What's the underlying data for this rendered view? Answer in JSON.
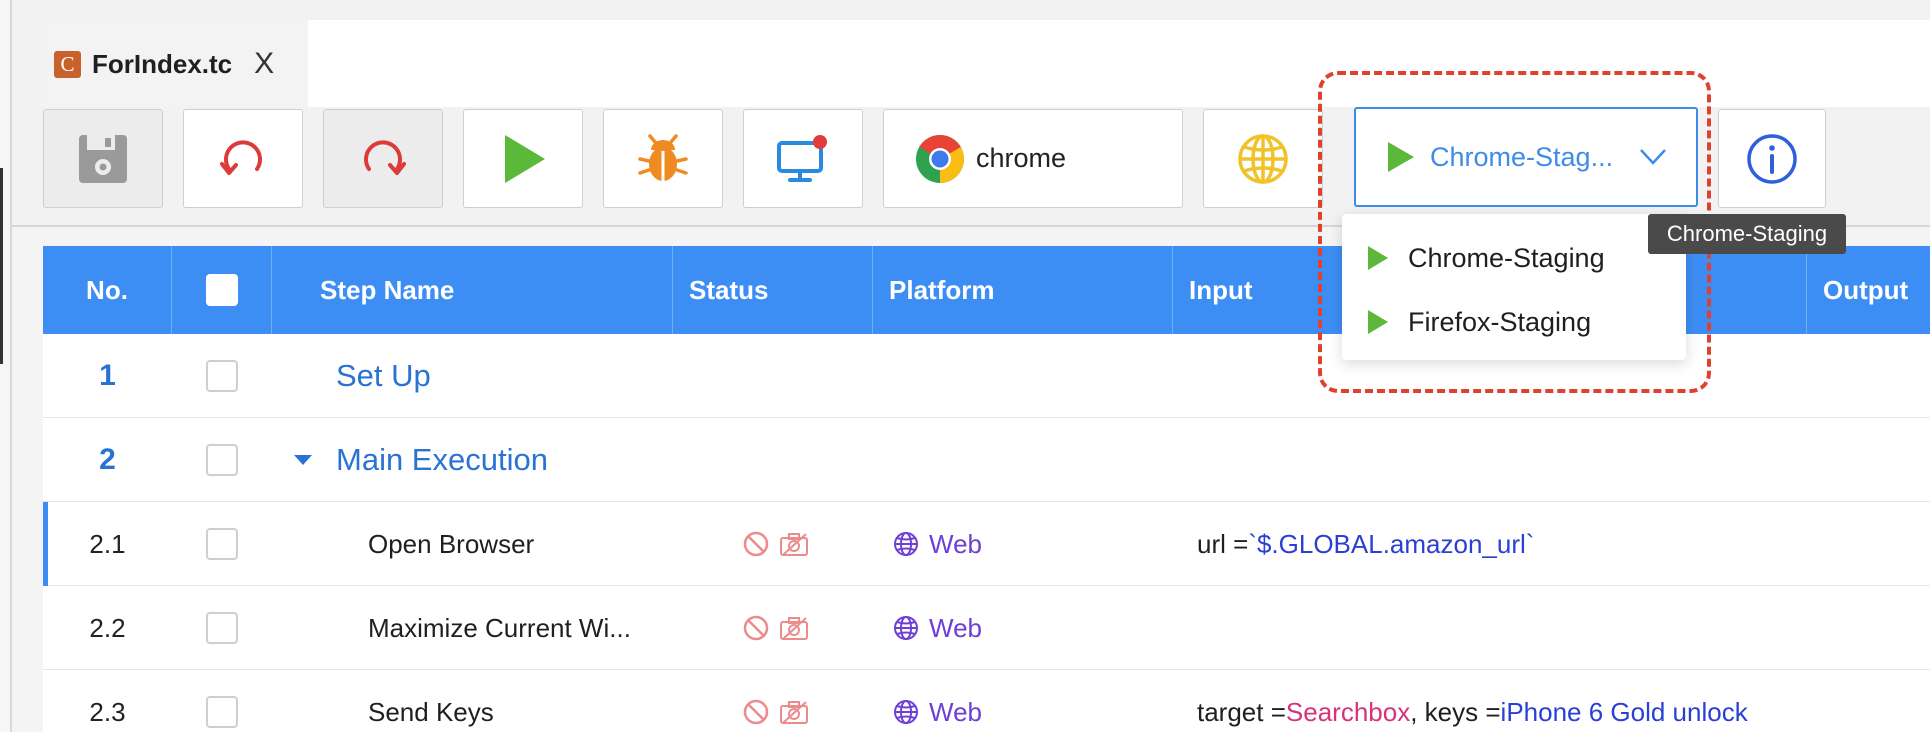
{
  "file_tab": {
    "icon_letter": "C",
    "name": "ForIndex.tc",
    "close": "X"
  },
  "toolbar": {
    "save": "save-icon",
    "undo": "undo-icon",
    "redo": "redo-icon",
    "run": "play-icon",
    "debug": "bug-icon",
    "remote": "monitor-icon",
    "browser_label": "chrome",
    "globe": "globe-icon",
    "environment_selected": "Chrome-Stag...",
    "info": "info-icon"
  },
  "environment_menu": {
    "items": [
      {
        "label": "Chrome-Staging"
      },
      {
        "label": "Firefox-Staging"
      }
    ],
    "tooltip": "Chrome-Staging"
  },
  "table": {
    "columns": {
      "no": "No.",
      "step_name": "Step Name",
      "status": "Status",
      "platform": "Platform",
      "input": "Input",
      "output": "Output"
    },
    "rows": [
      {
        "no": "1",
        "name": "Set Up",
        "type": "group"
      },
      {
        "no": "2",
        "name": "Main Execution",
        "type": "group"
      },
      {
        "no": "2.1",
        "name": "Open Browser",
        "platform": "Web",
        "input_key": "url = ",
        "input_value": "`$.GLOBAL.amazon_url`"
      },
      {
        "no": "2.2",
        "name": "Maximize Current Wi...",
        "platform": "Web"
      },
      {
        "no": "2.3",
        "name": "Send Keys",
        "platform": "Web",
        "input_key": "target = ",
        "input_value_pink": "Searchbox",
        "input_key2": ", keys = ",
        "input_value": "iPhone 6 Gold unlock"
      }
    ]
  },
  "colors": {
    "header_blue": "#3d8ef4",
    "link_blue": "#2a73d4",
    "highlight_red": "#e0412f",
    "platform_purple": "#6e3fd6",
    "run_green": "#5cb83a"
  }
}
